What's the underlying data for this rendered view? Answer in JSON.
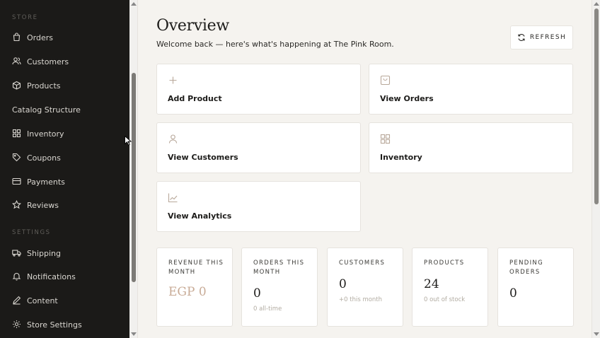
{
  "sidebar": {
    "store_label": "STORE",
    "settings_label": "SETTINGS",
    "store_items": [
      {
        "label": "Orders",
        "icon": "shopping-bag-icon"
      },
      {
        "label": "Customers",
        "icon": "users-icon"
      },
      {
        "label": "Products",
        "icon": "box-icon"
      },
      {
        "label": "Catalog Structure",
        "icon": ""
      },
      {
        "label": "Inventory",
        "icon": "grid-icon"
      },
      {
        "label": "Coupons",
        "icon": "tag-icon"
      },
      {
        "label": "Payments",
        "icon": "credit-card-icon"
      },
      {
        "label": "Reviews",
        "icon": "star-icon"
      }
    ],
    "settings_items": [
      {
        "label": "Shipping",
        "icon": "truck-icon"
      },
      {
        "label": "Notifications",
        "icon": "bell-icon"
      },
      {
        "label": "Content",
        "icon": "pencil-icon"
      },
      {
        "label": "Store Settings",
        "icon": "gear-icon"
      }
    ]
  },
  "header": {
    "title": "Overview",
    "subtitle": "Welcome back — here's what's happening at The Pink Room.",
    "refresh_label": "REFRESH"
  },
  "actions": [
    {
      "label": "Add Product",
      "icon": "plus-icon"
    },
    {
      "label": "View Orders",
      "icon": "shopping-bag-icon"
    },
    {
      "label": "View Customers",
      "icon": "user-icon"
    },
    {
      "label": "Inventory",
      "icon": "grid-icon"
    },
    {
      "label": "View Analytics",
      "icon": "chart-line-icon"
    }
  ],
  "stats": [
    {
      "label": "REVENUE THIS MONTH",
      "value": "EGP 0",
      "sub": ""
    },
    {
      "label": "ORDERS THIS MONTH",
      "value": "0",
      "sub": "0 all-time"
    },
    {
      "label": "CUSTOMERS",
      "value": "0",
      "sub": "+0 this month"
    },
    {
      "label": "PRODUCTS",
      "value": "24",
      "sub": "0 out of stock"
    },
    {
      "label": "PENDING ORDERS",
      "value": "0",
      "sub": ""
    }
  ],
  "colors": {
    "sidebar_bg": "#1b1a18",
    "page_bg": "#f5f3ef",
    "accent": "#c8ab96"
  }
}
